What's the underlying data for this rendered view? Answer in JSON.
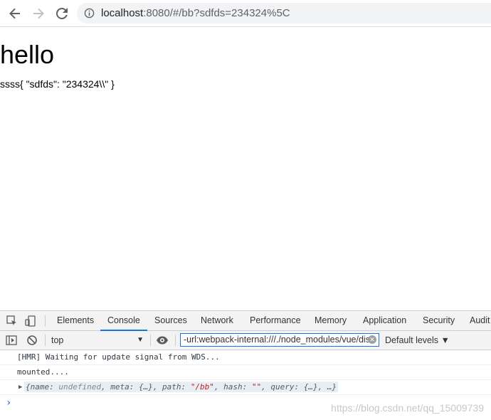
{
  "browser": {
    "url_host": "localhost",
    "url_rest": ":8080/#/bb?sdfds=234324%5C",
    "icons": [
      "back-arrow-icon",
      "forward-arrow-icon",
      "reload-icon",
      "info-icon"
    ]
  },
  "page": {
    "heading": "hello",
    "line": "ssss{ \"sdfds\": \"234324\\\\\" }"
  },
  "devtools": {
    "tabs": [
      "Elements",
      "Console",
      "Sources",
      "Network",
      "Performance",
      "Memory",
      "Application",
      "Security",
      "Audit"
    ],
    "active_tab": "Console",
    "context": "top",
    "filter_value": "-url:webpack-internal:///./node_modules/vue/dis",
    "levels": "Default levels ▼",
    "messages": [
      "[HMR] Waiting for update signal from WDS...",
      "mounted...."
    ],
    "object_log": {
      "prefix": "{name: ",
      "undefined": "undefined",
      "mid": ", meta: {…}, path: ",
      "path": "\"/bb\"",
      "mid2": ", hash: ",
      "hash": "\"\"",
      "suffix": ", query: {…}, …}"
    },
    "prompt": "›"
  },
  "watermark": "https://blog.csdn.net/qq_15009739",
  "colors": {
    "accent": "#1a73e8",
    "string": "#c41a16",
    "toolbar_bg": "#f3f3f3"
  }
}
